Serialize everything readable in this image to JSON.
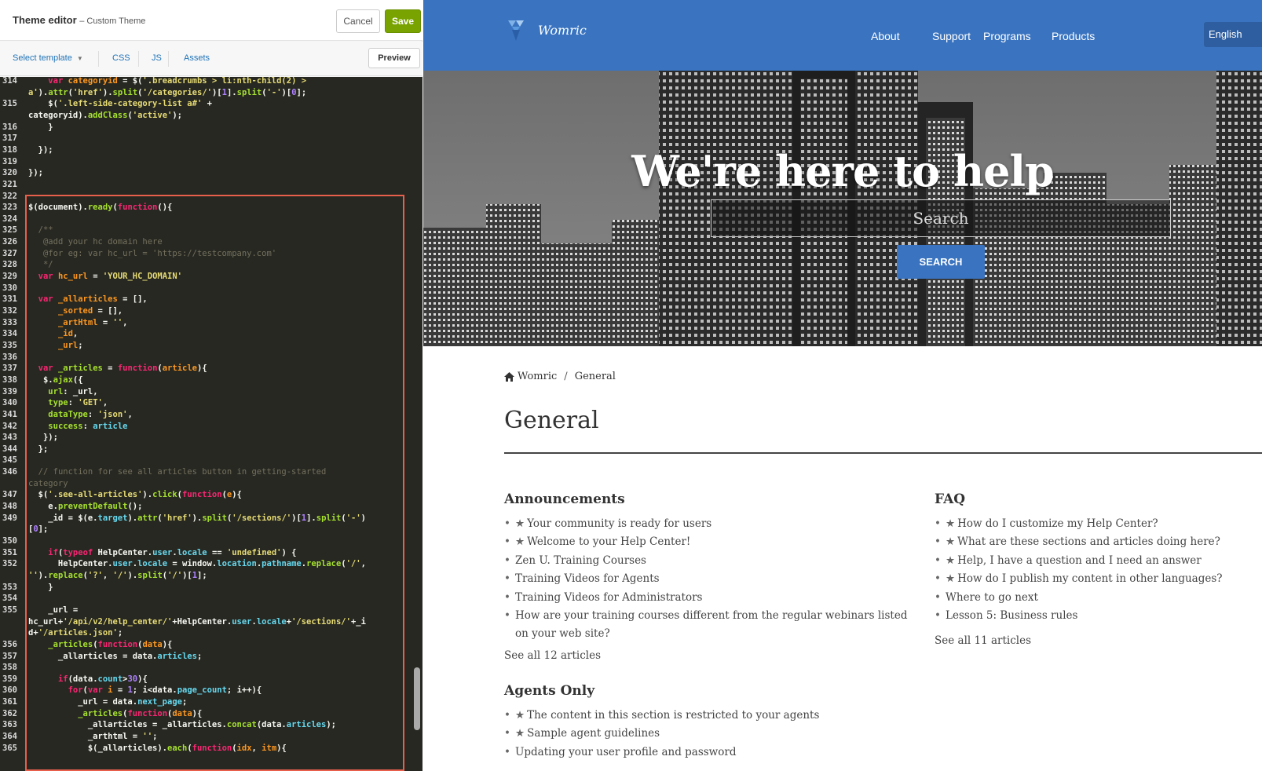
{
  "editor": {
    "title": "Theme editor",
    "subtitle": "– Custom Theme",
    "cancel_label": "Cancel",
    "save_label": "Save",
    "toolbar": {
      "select_template": "Select template",
      "css": "CSS",
      "js": "JS",
      "assets": "Assets",
      "preview": "Preview"
    },
    "code_lines": [
      {
        "n": "314",
        "html": "    <span class=\"k\">var</span> <span class=\"o\">categoryid</span> = $(<span class=\"s\">'.breadcrumbs &gt; li:nth-child(2) &gt;</span>"
      },
      {
        "n": "",
        "html": "<span class=\"s\">a'</span>).<span class=\"f\">attr</span>(<span class=\"s\">'href'</span>).<span class=\"f\">split</span>(<span class=\"s\">'/categories/'</span>)[<span class=\"n\">1</span>].<span class=\"f\">split</span>(<span class=\"s\">'-'</span>)[<span class=\"n\">0</span>];"
      },
      {
        "n": "315",
        "html": "    $(<span class=\"s\">'.left-side-category-list a#'</span> +"
      },
      {
        "n": "",
        "html": "categoryid).<span class=\"f\">addClass</span>(<span class=\"s\">'active'</span>);"
      },
      {
        "n": "316",
        "html": "    }"
      },
      {
        "n": "317",
        "html": ""
      },
      {
        "n": "318",
        "html": "  });"
      },
      {
        "n": "319",
        "html": ""
      },
      {
        "n": "320",
        "html": "});"
      },
      {
        "n": "321",
        "html": ""
      },
      {
        "n": "322",
        "html": ""
      },
      {
        "n": "323",
        "html": "$(document).<span class=\"f\">ready</span>(<span class=\"k\">function</span>(){"
      },
      {
        "n": "324",
        "html": ""
      },
      {
        "n": "325",
        "html": "  <span class=\"c\">/**</span>"
      },
      {
        "n": "326",
        "html": "  <span class=\"c\"> @add your hc domain here</span>"
      },
      {
        "n": "327",
        "html": "  <span class=\"c\"> @for eg: var hc_url = 'https://testcompany.com'</span>"
      },
      {
        "n": "328",
        "html": "  <span class=\"c\"> */</span>"
      },
      {
        "n": "329",
        "html": "  <span class=\"k\">var</span> <span class=\"o\">hc_url</span> = <span class=\"s\">'YOUR_HC_DOMAIN'</span>"
      },
      {
        "n": "330",
        "html": ""
      },
      {
        "n": "331",
        "html": "  <span class=\"k\">var</span> <span class=\"o\">_allarticles</span> = [],"
      },
      {
        "n": "332",
        "html": "      <span class=\"o\">_sorted</span> = [],"
      },
      {
        "n": "333",
        "html": "      <span class=\"o\">_artHtml</span> = <span class=\"s\">''</span>,"
      },
      {
        "n": "334",
        "html": "      <span class=\"o\">_id</span>,"
      },
      {
        "n": "335",
        "html": "      <span class=\"o\">_url</span>;"
      },
      {
        "n": "336",
        "html": ""
      },
      {
        "n": "337",
        "html": "  <span class=\"k\">var</span> <span class=\"f\">_articles</span> = <span class=\"k\">function</span>(<span class=\"o\">article</span>){"
      },
      {
        "n": "338",
        "html": "   $.<span class=\"f\">ajax</span>({"
      },
      {
        "n": "339",
        "html": "    <span class=\"f\">url</span>: _url,"
      },
      {
        "n": "340",
        "html": "    <span class=\"f\">type</span>: <span class=\"s\">'GET'</span>,"
      },
      {
        "n": "341",
        "html": "    <span class=\"f\">dataType</span>: <span class=\"s\">'json'</span>,"
      },
      {
        "n": "342",
        "html": "    <span class=\"f\">success</span>: <span class=\"v\">article</span>"
      },
      {
        "n": "343",
        "html": "   });"
      },
      {
        "n": "344",
        "html": "  };"
      },
      {
        "n": "345",
        "html": ""
      },
      {
        "n": "346",
        "html": "  <span class=\"c\">// function for see all articles button in getting-started</span>"
      },
      {
        "n": "",
        "html": "<span class=\"c\">category</span>"
      },
      {
        "n": "347",
        "html": "  $(<span class=\"s\">'.see-all-articles'</span>).<span class=\"f\">click</span>(<span class=\"k\">function</span>(<span class=\"o\">e</span>){"
      },
      {
        "n": "348",
        "html": "    e.<span class=\"f\">preventDefault</span>();"
      },
      {
        "n": "349",
        "html": "    _id = $(e.<span class=\"v\">target</span>).<span class=\"f\">attr</span>(<span class=\"s\">'href'</span>).<span class=\"f\">split</span>(<span class=\"s\">'/sections/'</span>)[<span class=\"n\">1</span>].<span class=\"f\">split</span>(<span class=\"s\">'-'</span>)"
      },
      {
        "n": "",
        "html": "[<span class=\"n\">0</span>];"
      },
      {
        "n": "350",
        "html": ""
      },
      {
        "n": "351",
        "html": "    <span class=\"k\">if</span>(<span class=\"k\">typeof</span> HelpCenter.<span class=\"v\">user</span>.<span class=\"v\">locale</span> == <span class=\"s\">'undefined'</span>) {"
      },
      {
        "n": "352",
        "html": "      HelpCenter.<span class=\"v\">user</span>.<span class=\"v\">locale</span> = window.<span class=\"v\">location</span>.<span class=\"v\">pathname</span>.<span class=\"f\">replace</span>(<span class=\"s\">'/'</span>,"
      },
      {
        "n": "",
        "html": "<span class=\"s\">''</span>).<span class=\"f\">replace</span>(<span class=\"s\">'?'</span>, <span class=\"s\">'/'</span>).<span class=\"f\">split</span>(<span class=\"s\">'/'</span>)[<span class=\"n\">1</span>];"
      },
      {
        "n": "353",
        "html": "    }"
      },
      {
        "n": "354",
        "html": ""
      },
      {
        "n": "355",
        "html": "    _url ="
      },
      {
        "n": "",
        "html": "hc_url+<span class=\"s\">'/api/v2/help_center/'</span>+HelpCenter.<span class=\"v\">user</span>.<span class=\"v\">locale</span>+<span class=\"s\">'/sections/'</span>+_i"
      },
      {
        "n": "",
        "html": "d+<span class=\"s\">'/articles.json'</span>;"
      },
      {
        "n": "356",
        "html": "    <span class=\"f\">_articles</span>(<span class=\"k\">function</span>(<span class=\"o\">data</span>){"
      },
      {
        "n": "357",
        "html": "      _allarticles = data.<span class=\"v\">articles</span>;"
      },
      {
        "n": "358",
        "html": ""
      },
      {
        "n": "359",
        "html": "      <span class=\"k\">if</span>(data.<span class=\"v\">count</span>&gt;<span class=\"n\">30</span>){"
      },
      {
        "n": "360",
        "html": "        <span class=\"k\">for</span>(<span class=\"k\">var</span> <span class=\"o\">i</span> = <span class=\"n\">1</span>; i&lt;data.<span class=\"v\">page_count</span>; i++){"
      },
      {
        "n": "361",
        "html": "          _url = data.<span class=\"v\">next_page</span>;"
      },
      {
        "n": "362",
        "html": "          <span class=\"f\">_articles</span>(<span class=\"k\">function</span>(<span class=\"o\">data</span>){"
      },
      {
        "n": "363",
        "html": "            _allarticles = _allarticles.<span class=\"f\">concat</span>(data.<span class=\"v\">articles</span>);"
      },
      {
        "n": "364",
        "html": "            _arthtml = <span class=\"s\">''</span>;"
      },
      {
        "n": "365",
        "html": "            $(_allarticles).<span class=\"f\">each</span>(<span class=\"k\">function</span>(<span class=\"o\">idx</span>, <span class=\"o\">itm</span>){"
      }
    ]
  },
  "site": {
    "logo_text": "Womric",
    "nav": [
      "About",
      "Support",
      "Programs",
      "Products"
    ],
    "language": "English",
    "hero_title": "We're here to help",
    "search_placeholder": "Search",
    "search_button": "SEARCH",
    "breadcrumb": [
      "Womric",
      "General"
    ],
    "page_title": "General",
    "sections": [
      {
        "title": "Announcements",
        "articles": [
          {
            "text": "Your community is ready for users",
            "starred": true
          },
          {
            "text": "Welcome to your Help Center!",
            "starred": true
          },
          {
            "text": "Zen U. Training Courses",
            "starred": false
          },
          {
            "text": "Training Videos for Agents",
            "starred": false
          },
          {
            "text": "Training Videos for Administrators",
            "starred": false
          },
          {
            "text": "How are your training courses different from the regular webinars listed on your web site?",
            "starred": false
          }
        ],
        "see_all": "See all 12 articles"
      },
      {
        "title": "FAQ",
        "articles": [
          {
            "text": "How do I customize my Help Center?",
            "starred": true
          },
          {
            "text": "What are these sections and articles doing here?",
            "starred": true
          },
          {
            "text": "Help, I have a question and I need an answer",
            "starred": true
          },
          {
            "text": "How do I publish my content in other languages?",
            "starred": true
          },
          {
            "text": "Where to go next",
            "starred": false
          },
          {
            "text": "Lesson 5: Business rules",
            "starred": false
          }
        ],
        "see_all": "See all 11 articles"
      },
      {
        "title": "Agents Only",
        "articles": [
          {
            "text": "The content in this section is restricted to your agents",
            "starred": true
          },
          {
            "text": "Sample agent guidelines",
            "starred": true
          },
          {
            "text": "Updating your user profile and password",
            "starred": false
          }
        ],
        "see_all": ""
      }
    ]
  },
  "colors": {
    "save_green": "#78a300",
    "brand_blue": "#3a74c0",
    "code_bg": "#272822",
    "highlight_red": "#e8604c"
  }
}
